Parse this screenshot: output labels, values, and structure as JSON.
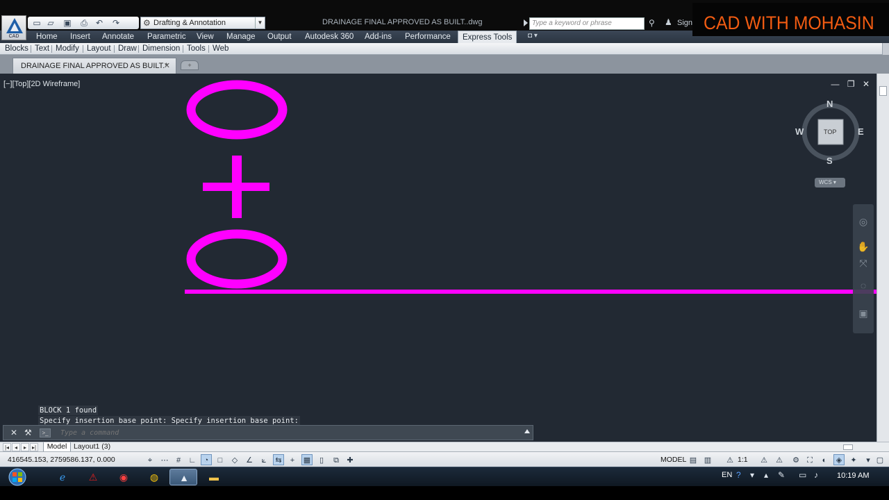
{
  "brand": {
    "text": "CAD WITH MOHASIN",
    "color": "#f25c12"
  },
  "app": {
    "logo_caption": "CAD",
    "document_title": "DRAINAGE FINAL APPROVED AS BUILT..dwg"
  },
  "quick_access": {
    "icons": [
      "new-file-icon",
      "open-folder-icon",
      "save-icon",
      "print-icon",
      "undo-icon",
      "redo-icon"
    ],
    "workspace": "Drafting & Annotation"
  },
  "search": {
    "placeholder": "Type a keyword or phrase",
    "signin_label": "Sign"
  },
  "ribbon": {
    "tabs": [
      {
        "label": "Home",
        "active": false
      },
      {
        "label": "Insert",
        "active": false
      },
      {
        "label": "Annotate",
        "active": false
      },
      {
        "label": "Parametric",
        "active": false
      },
      {
        "label": "View",
        "active": false
      },
      {
        "label": "Manage",
        "active": false
      },
      {
        "label": "Output",
        "active": false
      },
      {
        "label": "Autodesk 360",
        "active": false
      },
      {
        "label": "Add-ins",
        "active": false
      },
      {
        "label": "Performance",
        "active": false
      },
      {
        "label": "Express Tools",
        "active": true
      }
    ]
  },
  "menu": {
    "items": [
      "Blocks",
      "Text",
      "Modify",
      "Layout",
      "Draw",
      "Dimension",
      "Tools",
      "Web"
    ]
  },
  "file_tab": {
    "label": "DRAINAGE FINAL APPROVED AS BUILT.*",
    "close_glyph": "✕"
  },
  "viewport": {
    "label": "[−][Top][2D Wireframe]",
    "controls": [
      "—",
      "❐",
      "✕"
    ],
    "drawing_text": "0+0",
    "drawing_color": "#ff00ff"
  },
  "viewcube": {
    "north": "N",
    "south": "S",
    "east": "E",
    "west": "W",
    "face": "TOP",
    "wcs_label": "WCS"
  },
  "command": {
    "history": [
      "BLOCK 1 found",
      "Specify insertion base point: Specify insertion base point:"
    ],
    "placeholder": "Type a command"
  },
  "layout_tabs": {
    "model": "Model",
    "layout1": "Layout1 (3)"
  },
  "status": {
    "coordinates": "416545.153, 2759586.137, 0.000",
    "model_label": "MODEL",
    "scale_label": "1:1"
  },
  "taskbar": {
    "apps": [
      "internet-explorer-icon",
      "acrobat-icon",
      "video-recorder-icon",
      "chrome-icon",
      "autocad-icon",
      "file-explorer-icon"
    ],
    "language": "EN",
    "clock": "10:19 AM"
  }
}
